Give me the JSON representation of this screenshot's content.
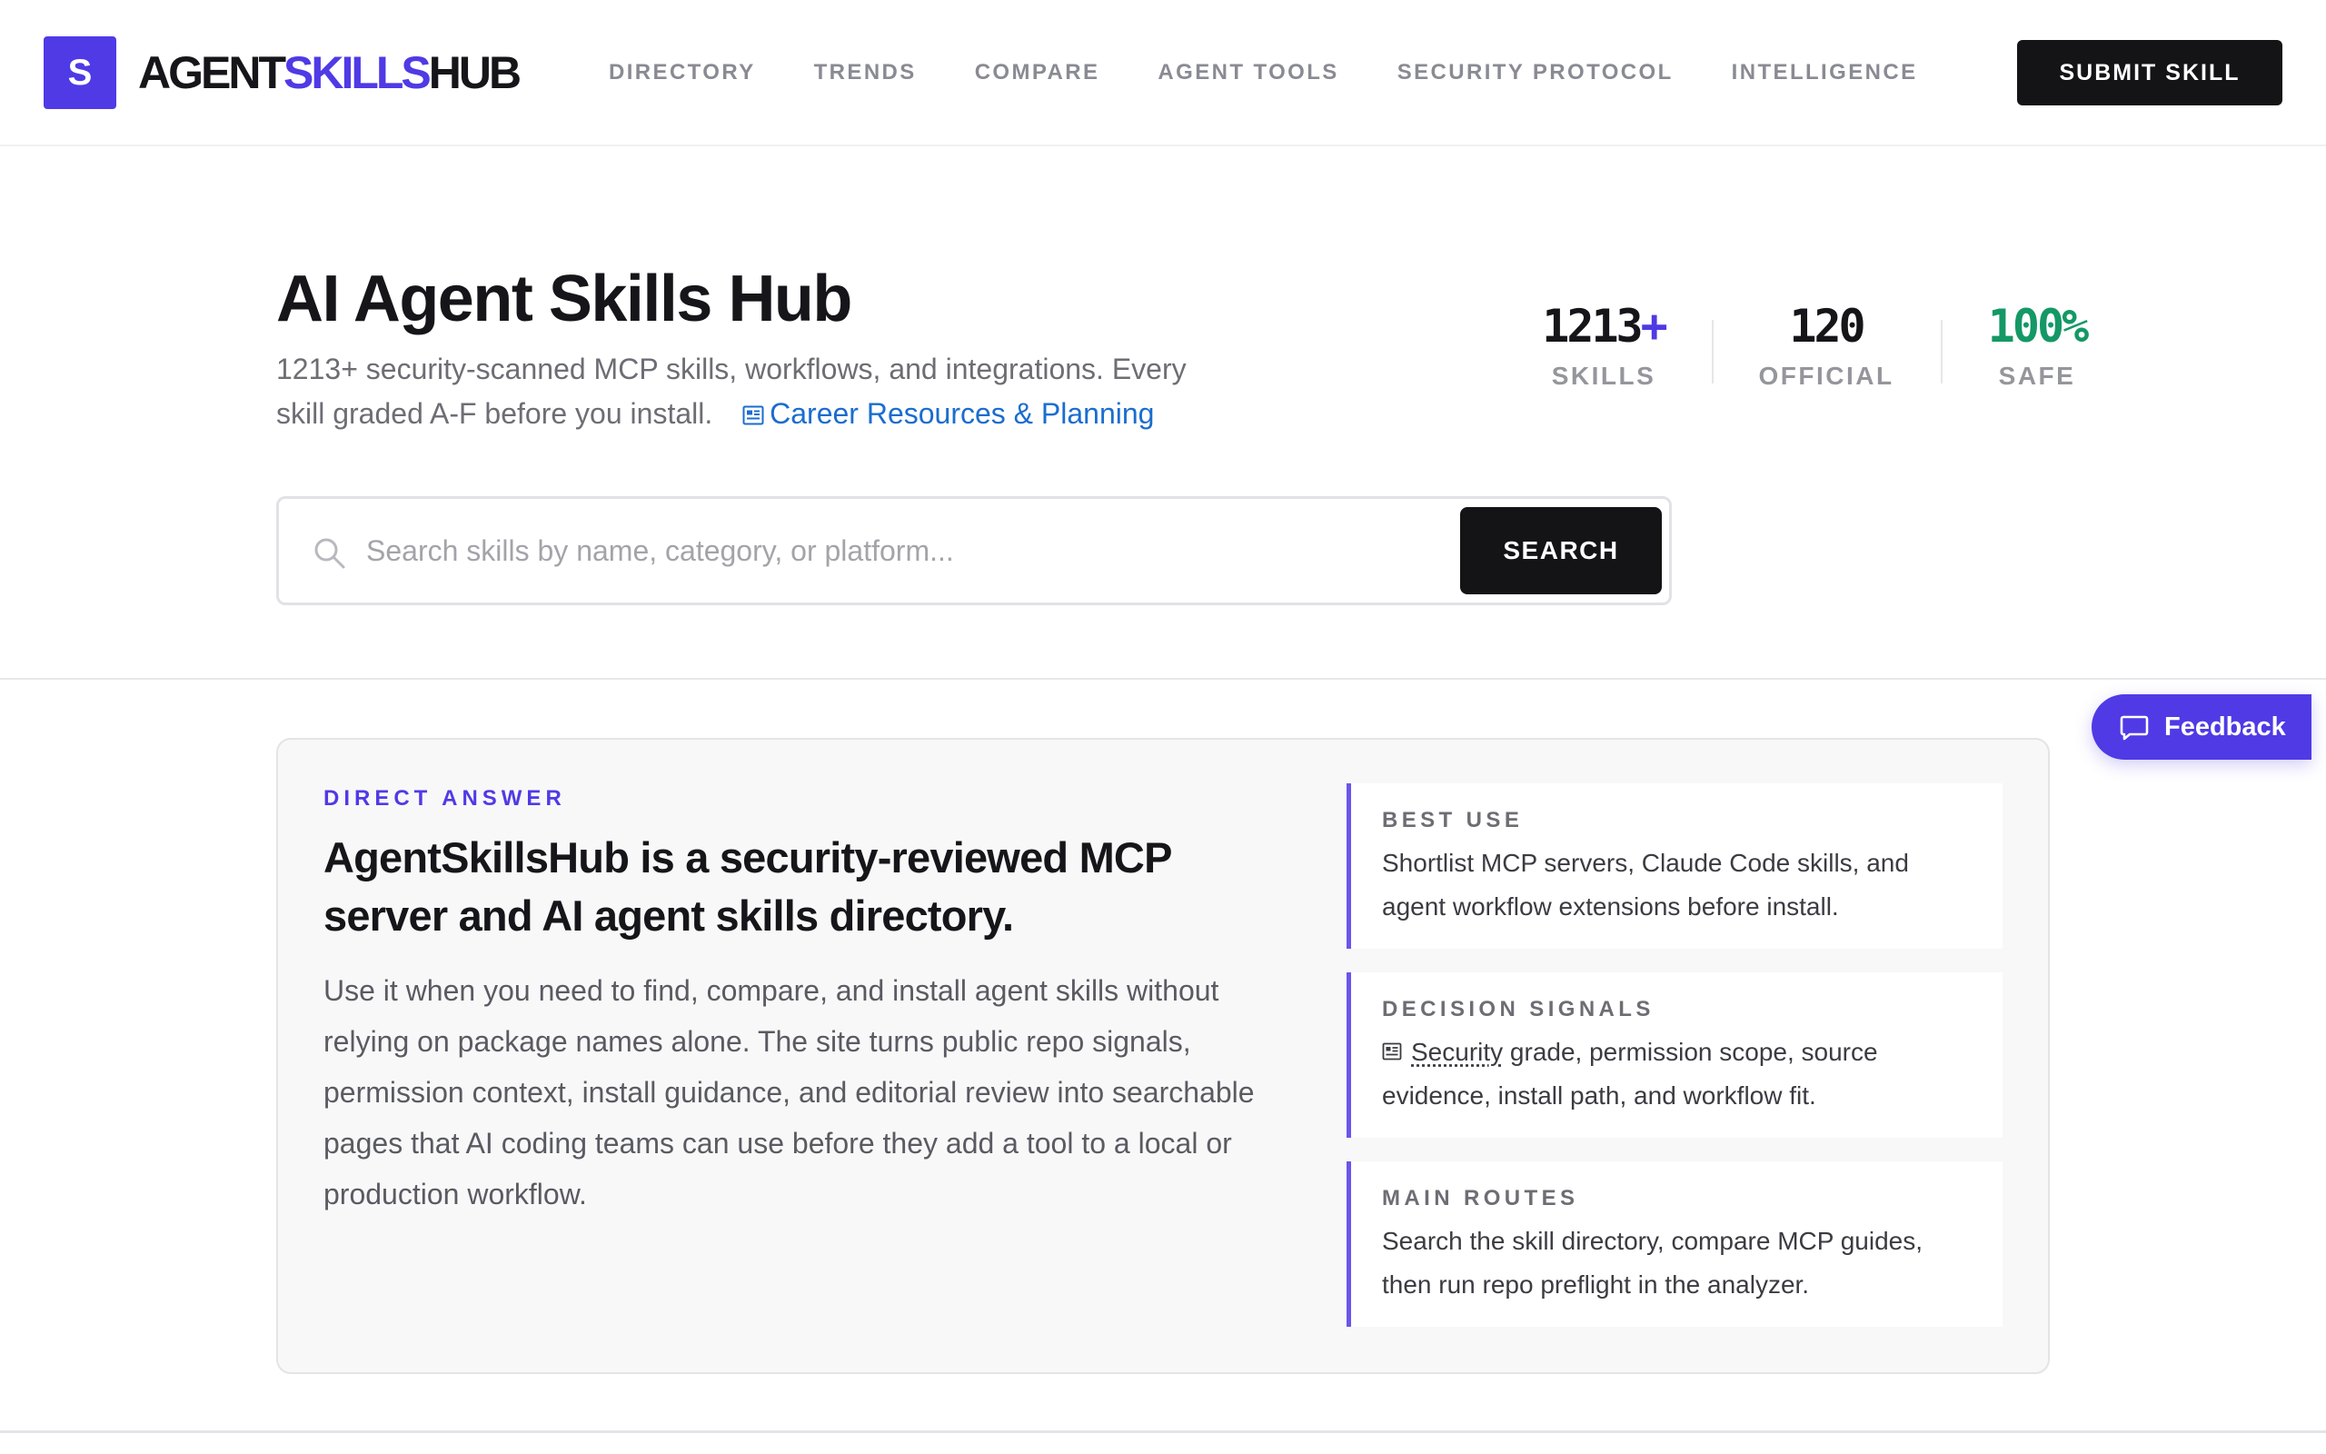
{
  "header": {
    "logo_letter": "S",
    "brand_part1": "AGENT",
    "brand_part2": "SKILLS",
    "brand_part3": "HUB",
    "nav": [
      "DIRECTORY",
      "TRENDS",
      "COMPARE",
      "AGENT TOOLS",
      "SECURITY PROTOCOL",
      "INTELLIGENCE"
    ],
    "submit_label": "SUBMIT SKILL"
  },
  "hero": {
    "title": "AI Agent Skills Hub",
    "description": "1213+ security-scanned MCP skills, workflows, and integrations. Every skill graded A-F before you install.",
    "link_icon": "newspaper-icon",
    "link_label": "Career Resources & Planning"
  },
  "stats": [
    {
      "value": "1213",
      "suffix": "+",
      "label": "SKILLS"
    },
    {
      "value": "120",
      "label": "OFFICIAL"
    },
    {
      "value": "100%",
      "label": "SAFE"
    }
  ],
  "search": {
    "placeholder": "Search skills by name, category, or platform...",
    "button_label": "SEARCH",
    "icon": "search-icon"
  },
  "feedback": {
    "label": "Feedback",
    "icon": "chat-bubble-icon"
  },
  "answer": {
    "eyebrow": "DIRECT ANSWER",
    "heading": "AgentSkillsHub is a security-reviewed MCP server and AI agent skills directory.",
    "body": "Use it when you need to find, compare, and install agent skills without relying on package names alone. The site turns public repo signals, permission context, install guidance, and editorial review into searchable pages that AI coding teams can use before they add a tool to a local or production workflow.",
    "side": [
      {
        "label": "BEST USE",
        "text": "Shortlist MCP servers, Claude Code skills, and agent workflow extensions before install."
      },
      {
        "label": "DECISION SIGNALS",
        "link": "Security",
        "text": " grade, permission scope, source evidence, install path, and workflow fit."
      },
      {
        "label": "MAIN ROUTES",
        "text": "Search the skill directory, compare MCP guides, then run repo preflight in the analyzer."
      }
    ]
  },
  "colors": {
    "accent": "#4f3ae6",
    "dark": "#141416",
    "safe_green": "#149866",
    "link_blue": "#1a6dcf"
  }
}
